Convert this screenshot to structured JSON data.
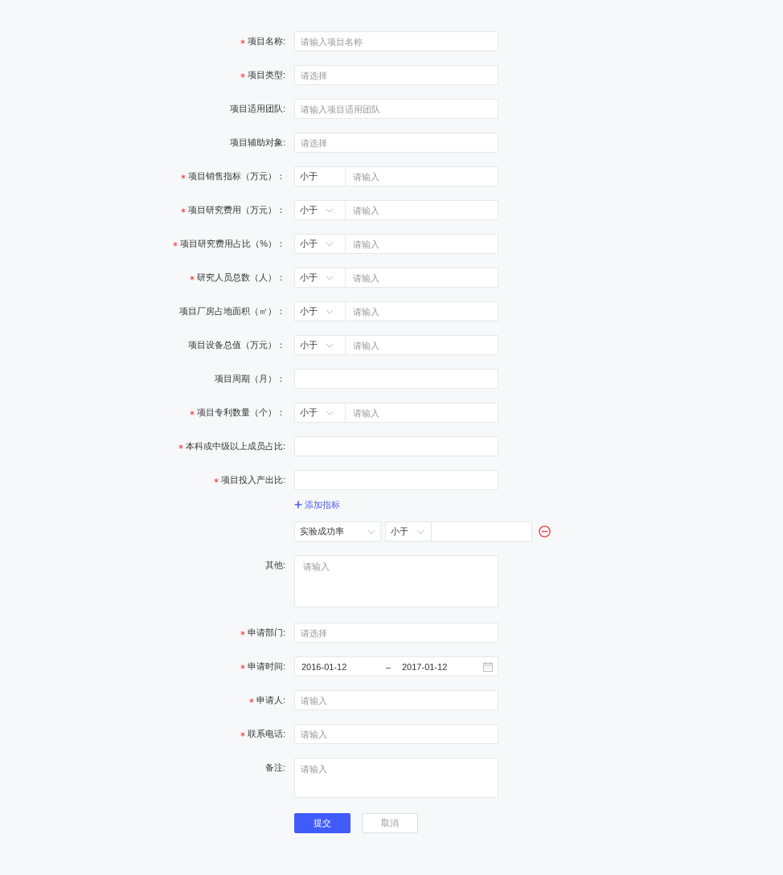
{
  "fields": [
    {
      "kind": "input",
      "required": true,
      "label": "项目名称:",
      "placeholder": "请输入项目名称"
    },
    {
      "kind": "input",
      "required": true,
      "label": "项目类型:",
      "placeholder": "请选择"
    },
    {
      "kind": "input",
      "required": false,
      "label": "项目适用团队:",
      "placeholder": "请输入项目适用团队"
    },
    {
      "kind": "input",
      "required": false,
      "label": "项目辅助对象:",
      "placeholder": "请选择"
    },
    {
      "kind": "compare",
      "required": true,
      "label": "项目销售指标（万元）：",
      "operator": "小于",
      "dropdown": false,
      "placeholder": "请输入"
    },
    {
      "kind": "compare",
      "required": true,
      "label": "项目研究费用（万元）：",
      "operator": "小于",
      "dropdown": true,
      "placeholder": "请输入"
    },
    {
      "kind": "compare",
      "required": true,
      "label": "项目研究费用占比（%）：",
      "operator": "小于",
      "dropdown": true,
      "placeholder": "请输入"
    },
    {
      "kind": "compare",
      "required": true,
      "label": "研究人员总数（人）：",
      "operator": "小于",
      "dropdown": true,
      "placeholder": "请输入"
    },
    {
      "kind": "compare",
      "required": false,
      "label": "项目厂房占地面积（㎡）：",
      "operator": "小于",
      "dropdown": true,
      "placeholder": "请输入"
    },
    {
      "kind": "compare",
      "required": false,
      "label": "项目设备总值（万元）：",
      "operator": "小于",
      "dropdown": true,
      "placeholder": "请输入"
    },
    {
      "kind": "input",
      "required": false,
      "label": "项目周期（月）："
    },
    {
      "kind": "compare",
      "required": true,
      "label": "项目专利数量（个）：",
      "operator": "小于",
      "dropdown": true,
      "placeholder": "请输入"
    },
    {
      "kind": "input",
      "required": true,
      "label": "本科或中级以上成员占比:"
    },
    {
      "kind": "input",
      "required": true,
      "label": "项目投入产出比:"
    },
    {
      "kind": "add-link",
      "text": "添加指标"
    },
    {
      "kind": "metric",
      "metric": "实验成功率",
      "operator": "小于"
    },
    {
      "kind": "textarea",
      "required": false,
      "label": "其他:",
      "placeholder": "请输入"
    },
    {
      "kind": "input",
      "required": true,
      "label": "申请部门:",
      "placeholder": "请选择"
    },
    {
      "kind": "daterange",
      "required": true,
      "label": "申请时间:",
      "start": "2016-01-12",
      "separator": "–",
      "end": "2017-01-12"
    },
    {
      "kind": "input",
      "required": true,
      "label": "申请人:",
      "placeholder": "请输入"
    },
    {
      "kind": "input",
      "required": true,
      "label": "联系电话:",
      "placeholder": "请输入"
    },
    {
      "kind": "short-textarea",
      "required": false,
      "label": "备注:",
      "placeholder": "请输入"
    }
  ],
  "buttons": [
    {
      "label": "提交",
      "primary": true
    },
    {
      "label": "取消",
      "primary": false
    }
  ]
}
